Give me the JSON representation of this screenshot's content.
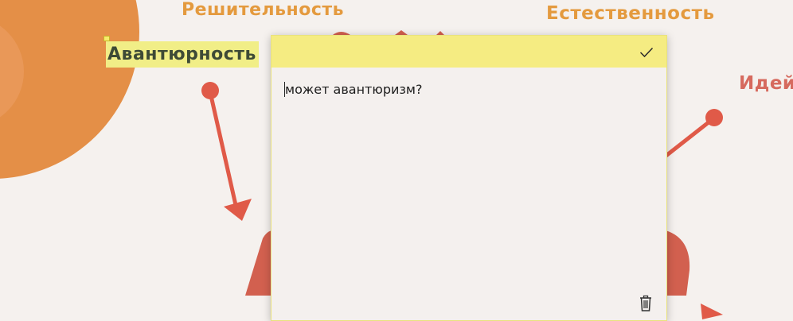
{
  "background_words": {
    "decisiveness": "Решительность",
    "naturalness": "Естественность",
    "ideas": "Идей",
    "adventurousness": "Авантюрность"
  },
  "note": {
    "text": "может авантюризм?",
    "check_icon": "check-icon",
    "delete_icon": "trash-icon",
    "header_color": "#f5ec82"
  },
  "colors": {
    "orange": "#e59148",
    "red": "#e25b4b",
    "highlight": "#f1ee87"
  }
}
